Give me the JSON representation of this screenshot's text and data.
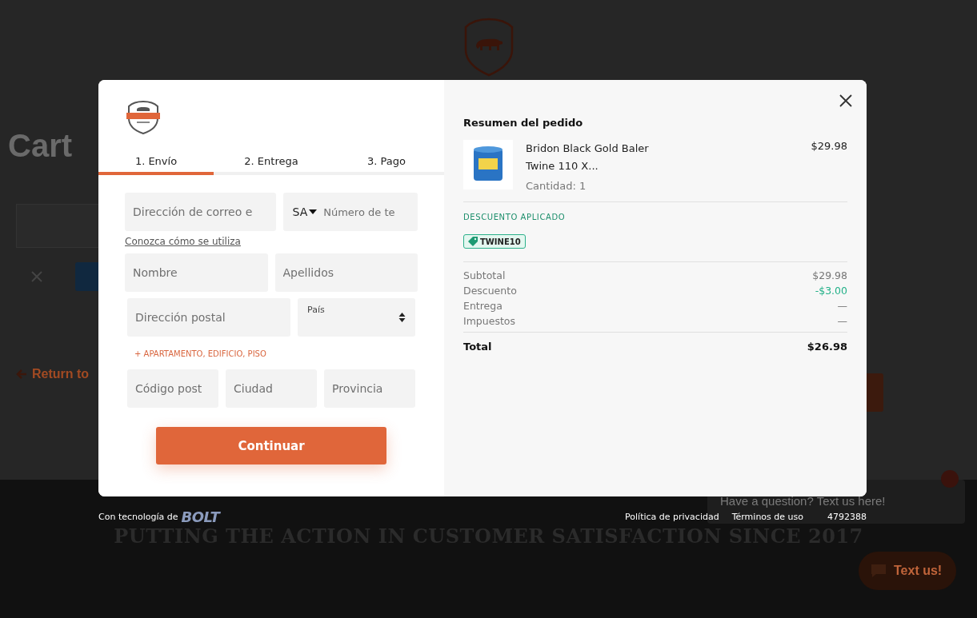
{
  "background_page": {
    "title": "Cart",
    "return_link": "Return to",
    "slogan": "PUTTING THE ACTION IN CUSTOMER SATISFACTION SINCE 2017",
    "chat_bubble": "Have a question? Text us here!",
    "chat_button": "Text us!"
  },
  "checkout": {
    "tabs": [
      {
        "label": "1. Envío",
        "selected": true
      },
      {
        "label": "2. Entrega",
        "selected": false
      },
      {
        "label": "3. Pago",
        "selected": false
      }
    ],
    "contact_row": {
      "email_placeholder": "Dirección de correo e",
      "country_code": "SA",
      "phone_placeholder": "Número de te"
    },
    "privacy_link": "Conozca cómo se utiliza",
    "name_row": [
      {
        "kind": "text",
        "placeholder": "Nombre"
      },
      {
        "kind": "text",
        "placeholder": "Apellidos"
      }
    ],
    "address_row": [
      {
        "kind": "text",
        "placeholder": "Dirección postal"
      },
      {
        "kind": "select",
        "label": "País"
      }
    ],
    "add_line_link": "+ APARTAMENTO, EDIFICIO, PISO",
    "city_row": [
      {
        "kind": "text",
        "placeholder": "Código post"
      },
      {
        "kind": "text",
        "placeholder": "Ciudad"
      },
      {
        "kind": "text",
        "placeholder": "Provincia"
      }
    ],
    "continue_button": "Continuar"
  },
  "summary": {
    "title": "Resumen del pedido",
    "item": {
      "name": "Bridon Black Gold Baler Twine 110 X...",
      "quantity": "Cantidad: 1",
      "price": "$29.98"
    },
    "discount_heading": "DESCUENTO APLICADO",
    "discount_code": "TWINE10",
    "lines": [
      {
        "kind": "normal",
        "label": "Subtotal",
        "value": "$29.98"
      },
      {
        "kind": "discount",
        "label": "Descuento",
        "value": "-$3.00"
      },
      {
        "kind": "normal",
        "label": "Entrega",
        "value": "—"
      },
      {
        "kind": "normal",
        "label": "Impuestos",
        "value": "—"
      }
    ],
    "total": {
      "label": "Total",
      "value": "$26.98"
    }
  },
  "footer": {
    "powered_by": "Con tecnología de",
    "brand": "BOLT",
    "links": [
      "Política de privacidad",
      "Términos de uso"
    ],
    "code": "4792388"
  }
}
